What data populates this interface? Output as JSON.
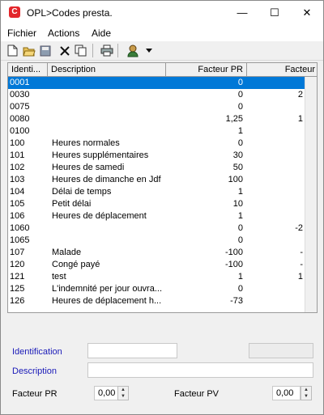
{
  "window": {
    "title": "OPL>Codes presta.",
    "app_icon": "C"
  },
  "titlebar": {
    "minimize": "—",
    "maximize": "☐",
    "close": "✕"
  },
  "menu": {
    "items": [
      "Fichier",
      "Actions",
      "Aide"
    ]
  },
  "toolbar": {
    "icons": [
      "new-document-icon",
      "open-folder-icon",
      "save-icon",
      "delete-icon",
      "copy-icon",
      "print-icon",
      "user-icon"
    ]
  },
  "grid": {
    "columns": [
      "Identi...",
      "Description",
      "Facteur PR",
      "Facteur"
    ],
    "rows": [
      {
        "id": "0001",
        "desc": "",
        "fpr": "0",
        "fpv": "",
        "selected": true
      },
      {
        "id": "0030",
        "desc": "",
        "fpr": "0",
        "fpv": "2"
      },
      {
        "id": "0075",
        "desc": "",
        "fpr": "0",
        "fpv": ""
      },
      {
        "id": "0080",
        "desc": "",
        "fpr": "1,25",
        "fpv": "1"
      },
      {
        "id": "0100",
        "desc": "",
        "fpr": "1",
        "fpv": ""
      },
      {
        "id": "100",
        "desc": "Heures normales",
        "fpr": "0",
        "fpv": ""
      },
      {
        "id": "101",
        "desc": "Heures supplémentaires",
        "fpr": "30",
        "fpv": ""
      },
      {
        "id": "102",
        "desc": "Heures de samedi",
        "fpr": "50",
        "fpv": ""
      },
      {
        "id": "103",
        "desc": "Heures de dimanche en Jdf",
        "fpr": "100",
        "fpv": ""
      },
      {
        "id": "104",
        "desc": "Délai de temps",
        "fpr": "1",
        "fpv": ""
      },
      {
        "id": "105",
        "desc": "Petit délai",
        "fpr": "10",
        "fpv": ""
      },
      {
        "id": "106",
        "desc": "Heures de déplacement",
        "fpr": "1",
        "fpv": ""
      },
      {
        "id": "1060",
        "desc": "",
        "fpr": "0",
        "fpv": "-2"
      },
      {
        "id": "1065",
        "desc": "",
        "fpr": "0",
        "fpv": ""
      },
      {
        "id": "107",
        "desc": "Malade",
        "fpr": "-100",
        "fpv": "-"
      },
      {
        "id": "120",
        "desc": "Congé payé",
        "fpr": "-100",
        "fpv": "-"
      },
      {
        "id": "121",
        "desc": "test",
        "fpr": "1",
        "fpv": "1"
      },
      {
        "id": "125",
        "desc": "L'indemnité per jour ouvra...",
        "fpr": "0",
        "fpv": ""
      },
      {
        "id": "126",
        "desc": "Heures de déplacement h...",
        "fpr": "-73",
        "fpv": ""
      }
    ]
  },
  "form": {
    "identification_label": "Identification",
    "description_label": "Description",
    "facteur_pr_label": "Facteur PR",
    "facteur_pr_value": "0,00",
    "facteur_pv_label": "Facteur PV",
    "facteur_pv_value": "0,00"
  },
  "colors": {
    "selection": "#0078d7",
    "field_label": "#1a1ab8",
    "brand": "#e3262b"
  }
}
